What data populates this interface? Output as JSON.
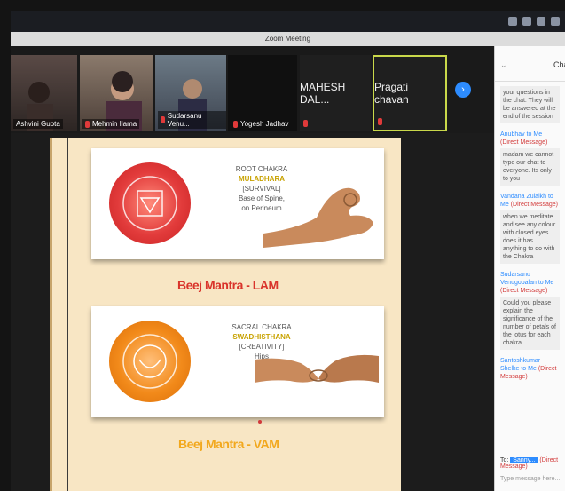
{
  "window": {
    "title": "Zoom Meeting"
  },
  "participants": [
    {
      "name": "Ashvini Gupta"
    },
    {
      "name": "Mehmin Ilama"
    },
    {
      "name": "Sudarsanu Venu..."
    },
    {
      "name": "Yogesh Jadhav"
    },
    {
      "name": "MAHESH DAL..."
    },
    {
      "name": "Pragati chavan"
    }
  ],
  "slide": {
    "card1": {
      "line1": "ROOT CHAKRA",
      "line2": "MULADHARA",
      "line3": "[SURVIVAL]",
      "line4": "Base of Spine,",
      "line5": "on Perineum"
    },
    "mantra1": "Beej Mantra - LAM",
    "card2": {
      "line1": "SACRAL CHAKRA",
      "line2": "SWADHISTHANA",
      "line3": "[CREATIVITY]",
      "line4": "Hips"
    },
    "mantra2": "Beej Mantra - VAM"
  },
  "chat": {
    "title": "Chat",
    "messages": [
      {
        "from": "",
        "dm": "",
        "text": "your questions in the chat. They will be answered at the end of the session"
      },
      {
        "from": "Anubhav to Me",
        "dm": "(Direct Message)",
        "text": "madam we cannot type our chat to everyone. Its only to you"
      },
      {
        "from": "Vandana Zulaikh to Me",
        "dm": "(Direct Message)",
        "text": "when we meditate and see any colour with closed eyes does it has anything to do with the Chakra"
      },
      {
        "from": "Sudarsanu Venugopalan to Me",
        "dm": "(Direct Message)",
        "text": "Could you please explain the significance of the number of petals of the lotus for each chakra"
      },
      {
        "from": "Santoshkumar Shelke to Me",
        "dm": "(Direct Message)",
        "text": ""
      }
    ],
    "to_label": "To:",
    "to_selected": "Sanny...",
    "to_dm": "(Direct Message)",
    "input_placeholder": "Type message here..."
  },
  "colors": {
    "accent": "#2d8cff",
    "slide_bg": "#f8e6c4",
    "mantra1": "#d9342b",
    "mantra2": "#f2a81d",
    "root_chakra": "#e23b3b",
    "sacral_chakra": "#f28a1a"
  }
}
